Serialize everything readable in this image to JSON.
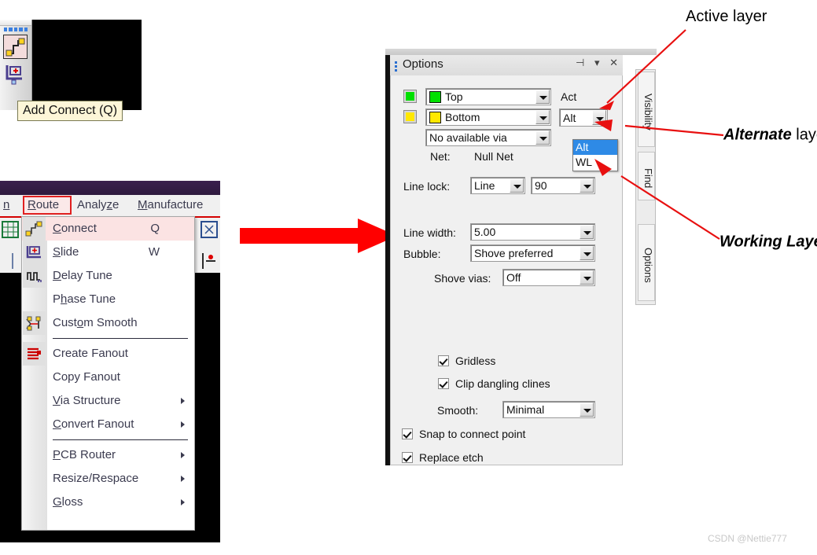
{
  "toolbar": {
    "tooltip": "Add Connect (Q)",
    "buttons": [
      {
        "name": "add-connect",
        "label": "Add Connect (Q)"
      },
      {
        "name": "slide",
        "label": "Slide"
      }
    ]
  },
  "menubar": {
    "items": [
      {
        "label": "n",
        "accel": ""
      },
      {
        "label": "Route",
        "accel": "R",
        "highlighted": true
      },
      {
        "label": "Analyze",
        "accel": "z"
      },
      {
        "label": "Manufacture",
        "accel": "M"
      }
    ]
  },
  "route_menu": {
    "items": [
      {
        "label": "Connect",
        "accel": "C",
        "shortcut": "Q",
        "icon": "connect-icon",
        "selected": true,
        "submenu": false
      },
      {
        "label": "Slide",
        "accel": "S",
        "shortcut": "W",
        "icon": "slide-icon",
        "selected": false,
        "submenu": false
      },
      {
        "label": "Delay Tune",
        "accel": "D",
        "shortcut": "",
        "icon": "delay-tune-icon",
        "selected": false,
        "submenu": false
      },
      {
        "label": "Phase Tune",
        "accel": "h",
        "shortcut": "",
        "icon": "",
        "selected": false,
        "submenu": false
      },
      {
        "label": "Custom Smooth",
        "accel": "o",
        "shortcut": "",
        "icon": "custom-smooth-icon",
        "selected": false,
        "submenu": false
      },
      {
        "separator": true
      },
      {
        "label": "Create Fanout",
        "accel": "",
        "shortcut": "",
        "icon": "create-fanout-icon",
        "selected": false,
        "submenu": false
      },
      {
        "label": "Copy Fanout",
        "accel": "",
        "shortcut": "",
        "icon": "",
        "selected": false,
        "submenu": false
      },
      {
        "label": "Via Structure",
        "accel": "V",
        "shortcut": "",
        "icon": "",
        "selected": false,
        "submenu": true
      },
      {
        "label": "Convert Fanout",
        "accel": "C",
        "shortcut": "",
        "icon": "",
        "selected": false,
        "submenu": true
      },
      {
        "separator": true
      },
      {
        "label": "PCB Router",
        "accel": "P",
        "shortcut": "",
        "icon": "",
        "selected": false,
        "submenu": true
      },
      {
        "label": "Resize/Respace",
        "accel": "",
        "shortcut": "",
        "icon": "",
        "selected": false,
        "submenu": true
      },
      {
        "label": "Gloss",
        "accel": "G",
        "shortcut": "",
        "icon": "",
        "selected": false,
        "submenu": true
      }
    ]
  },
  "options_panel": {
    "title": "Options",
    "titlebar_buttons": [
      "pin-icon",
      "menu-caret-icon",
      "close-icon"
    ],
    "active_layer": {
      "label": "Act",
      "value": "Top",
      "color": "#00e000"
    },
    "alternate_layer": {
      "label": "Alt",
      "value": "Bottom",
      "color": "#ffe800"
    },
    "via": {
      "value": "No available via"
    },
    "net": {
      "label": "Net:",
      "value": "Null Net"
    },
    "line_lock": {
      "label": "Line lock:",
      "mode": "Line",
      "angle": "90"
    },
    "line_width": {
      "label": "Line width:",
      "value": "5.00"
    },
    "bubble": {
      "label": "Bubble:",
      "value": "Shove preferred"
    },
    "shove_vias": {
      "label": "Shove vias:",
      "value": "Off"
    },
    "gridless": {
      "label": "Gridless",
      "checked": true
    },
    "clip_dangling": {
      "label": "Clip dangling clines",
      "checked": true
    },
    "smooth": {
      "label": "Smooth:",
      "value": "Minimal"
    },
    "snap_connect": {
      "label": "Snap to connect point",
      "checked": true
    },
    "replace_etch": {
      "label": "Replace etch",
      "checked": true
    },
    "alt_dropdown_options": [
      {
        "label": "Alt",
        "selected": true
      },
      {
        "label": "WL",
        "selected": false
      }
    ]
  },
  "side_tabs": [
    {
      "label": "Visibility"
    },
    {
      "label": "Find"
    },
    {
      "label": "Options"
    }
  ],
  "annotations": [
    {
      "name": "active-layer-annotation",
      "text": "Active layer",
      "style": "plain"
    },
    {
      "name": "alternate-layer-annotation",
      "em": "Alternate",
      "rest": " layer",
      "style": "mixed"
    },
    {
      "name": "working-layer-annotation",
      "text": "Working Layer",
      "style": "italic"
    }
  ],
  "watermark": "CSDN @Nettie777",
  "colors": {
    "accent_red": "#ff0000",
    "highlight_blue": "#2e8ae6",
    "menu_select": "#fbe3e3",
    "top_layer": "#00e000",
    "bottom_layer": "#ffe800"
  }
}
